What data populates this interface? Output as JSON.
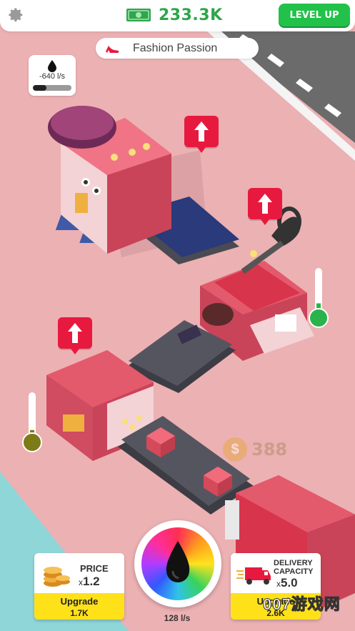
{
  "header": {
    "money_value": "233.3K",
    "level_up_label": "LEVEL UP"
  },
  "level": {
    "name": "Fashion Passion"
  },
  "ink": {
    "rate": "-640 l/s",
    "level": 0.35
  },
  "floating_coin": {
    "value": "388"
  },
  "price_card": {
    "label": "PRICE",
    "mult_prefix": "x",
    "mult_value": "1.2",
    "button_label": "Upgrade",
    "button_cost": "1.7K"
  },
  "delivery_card": {
    "label_line1": "DELIVERY",
    "label_line2": "CAPACITY",
    "mult_prefix": "x",
    "mult_value": "5.0",
    "button_label": "Upgrade",
    "button_cost": "2.6K"
  },
  "ink_wheel": {
    "rate": "128 l/s"
  },
  "thermometers": {
    "cutter_level": 0.25,
    "sewer_level": 0.2
  },
  "watermark": {
    "text": "007游戏网"
  },
  "colors": {
    "background": "#ecb1b3",
    "accent_green": "#22c24a",
    "money_green": "#2ea64a",
    "marker_red": "#e8193f",
    "card_yellow": "#ffe11a",
    "machine_pink": "#e35a6c"
  }
}
